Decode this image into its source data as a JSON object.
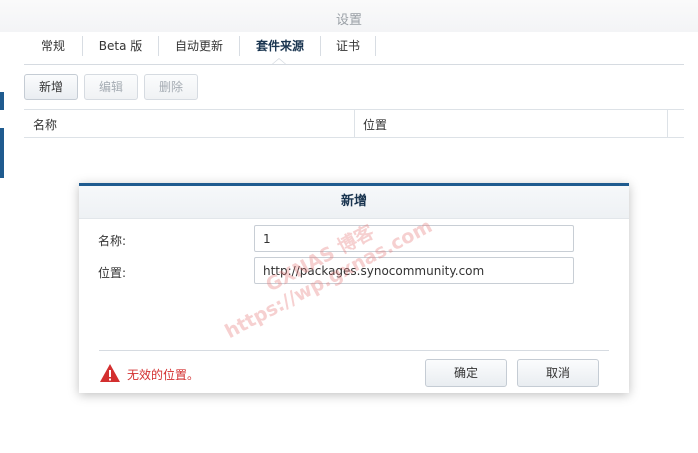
{
  "window": {
    "title": "设置"
  },
  "tabs": [
    {
      "label": "常规"
    },
    {
      "label": "Beta 版"
    },
    {
      "label": "自动更新"
    },
    {
      "label": "套件来源"
    },
    {
      "label": "证书"
    }
  ],
  "toolbar": {
    "add_label": "新增",
    "edit_label": "编辑",
    "delete_label": "删除"
  },
  "grid": {
    "columns": [
      {
        "label": "名称"
      },
      {
        "label": "位置"
      }
    ]
  },
  "dialog": {
    "title": "新增",
    "name_label": "名称:",
    "name_value": "1",
    "location_label": "位置:",
    "location_value": "http://packages.synocommunity.com",
    "error_text": "无效的位置。",
    "ok_label": "确定",
    "cancel_label": "取消"
  },
  "watermark": {
    "line1": "GXNAS 博客",
    "line2": "https://wp.gxnas.com"
  },
  "colors": {
    "accent": "#1f5b8f",
    "error": "#d32f2f"
  }
}
